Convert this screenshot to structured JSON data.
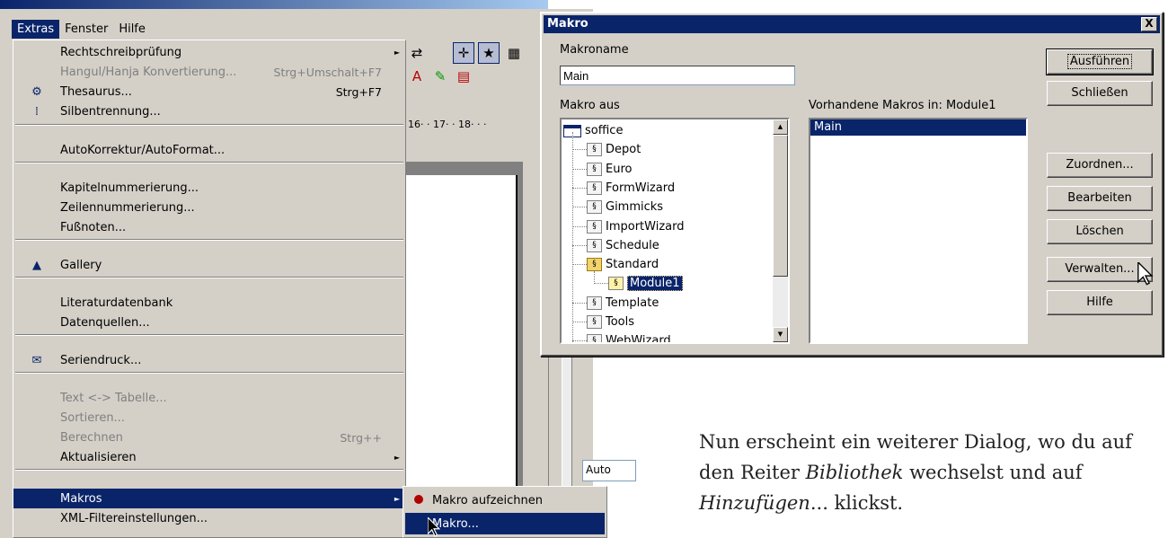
{
  "menubar": {
    "items": [
      {
        "label": "Extras"
      },
      {
        "label": "Fenster"
      },
      {
        "label": "Hilfe"
      }
    ]
  },
  "extras_menu": {
    "items": [
      {
        "label": "Rechtschreibprüfung",
        "shortcut": "",
        "submenu": true,
        "disabled": false,
        "icon": ""
      },
      {
        "label": "Hangul/Hanja Konvertierung...",
        "shortcut": "Strg+Umschalt+F7",
        "submenu": false,
        "disabled": true,
        "icon": ""
      },
      {
        "label": "Thesaurus...",
        "shortcut": "Strg+F7",
        "submenu": false,
        "disabled": false,
        "icon": "thesaurus-icon"
      },
      {
        "label": "Silbentrennung...",
        "shortcut": "",
        "submenu": false,
        "disabled": false,
        "icon": "hyphenation-icon"
      },
      {
        "label": "AutoKorrektur/AutoFormat...",
        "shortcut": "",
        "submenu": false,
        "disabled": false,
        "icon": ""
      },
      {
        "label": "Kapitelnummerierung...",
        "shortcut": "",
        "submenu": false,
        "disabled": false,
        "icon": ""
      },
      {
        "label": "Zeilennummerierung...",
        "shortcut": "",
        "submenu": false,
        "disabled": false,
        "icon": ""
      },
      {
        "label": "Fußnoten...",
        "shortcut": "",
        "submenu": false,
        "disabled": false,
        "icon": ""
      },
      {
        "label": "Gallery",
        "shortcut": "",
        "submenu": false,
        "disabled": false,
        "icon": "gallery-icon"
      },
      {
        "label": "Literaturdatenbank",
        "shortcut": "",
        "submenu": false,
        "disabled": false,
        "icon": ""
      },
      {
        "label": "Datenquellen...",
        "shortcut": "",
        "submenu": false,
        "disabled": false,
        "icon": ""
      },
      {
        "label": "Seriendruck...",
        "shortcut": "",
        "submenu": false,
        "disabled": false,
        "icon": "mail-merge-icon"
      },
      {
        "label": "Text <-> Tabelle...",
        "shortcut": "",
        "submenu": false,
        "disabled": true,
        "icon": ""
      },
      {
        "label": "Sortieren...",
        "shortcut": "",
        "submenu": false,
        "disabled": true,
        "icon": ""
      },
      {
        "label": "Berechnen",
        "shortcut": "Strg++",
        "submenu": false,
        "disabled": true,
        "icon": ""
      },
      {
        "label": "Aktualisieren",
        "shortcut": "",
        "submenu": true,
        "disabled": false,
        "icon": ""
      },
      {
        "label": "Makros",
        "shortcut": "",
        "submenu": true,
        "disabled": false,
        "icon": "",
        "highlight": true
      },
      {
        "label": "XML-Filtereinstellungen...",
        "shortcut": "",
        "submenu": false,
        "disabled": false,
        "icon": ""
      }
    ]
  },
  "makros_submenu": {
    "items": [
      {
        "label": "Makro aufzeichnen",
        "icon": "record-icon"
      },
      {
        "label": "Makro...",
        "icon": "",
        "highlight": true
      }
    ]
  },
  "background": {
    "ruler_text": "16· · 17· · 18· · ·",
    "combo_value": "Auto"
  },
  "dialog": {
    "title": "Makro",
    "close_label": "X",
    "macro_name_label": "Makroname",
    "macro_name_value": "Main",
    "macro_from_label": "Makro aus",
    "existing_macros_label": "Vorhandene Makros in: Module1",
    "tree": [
      {
        "label": "soffice",
        "level": 0,
        "type": "root"
      },
      {
        "label": "Depot",
        "level": 1,
        "type": "library"
      },
      {
        "label": "Euro",
        "level": 1,
        "type": "library"
      },
      {
        "label": "FormWizard",
        "level": 1,
        "type": "library"
      },
      {
        "label": "Gimmicks",
        "level": 1,
        "type": "library"
      },
      {
        "label": "ImportWizard",
        "level": 1,
        "type": "library"
      },
      {
        "label": "Schedule",
        "level": 1,
        "type": "library"
      },
      {
        "label": "Standard",
        "level": 1,
        "type": "library-open"
      },
      {
        "label": "Module1",
        "level": 2,
        "type": "module",
        "selected": true
      },
      {
        "label": "Template",
        "level": 1,
        "type": "library"
      },
      {
        "label": "Tools",
        "level": 1,
        "type": "library"
      },
      {
        "label": "WebWizard",
        "level": 1,
        "type": "library"
      }
    ],
    "macros": [
      {
        "label": "Main",
        "selected": true
      }
    ],
    "buttons": {
      "run": "Ausführen",
      "close": "Schließen",
      "assign": "Zuordnen...",
      "edit": "Bearbeiten",
      "delete": "Löschen",
      "organize": "Verwalten...",
      "help": "Hilfe"
    }
  },
  "caption": {
    "text_1": "Nun erscheint ein weiterer Dialog, wo du auf den Reiter ",
    "emphasis_1": "Bibliothek",
    "text_2": " wechselst und auf ",
    "emphasis_2": "Hinzufügen",
    "text_3": "... klickst."
  }
}
